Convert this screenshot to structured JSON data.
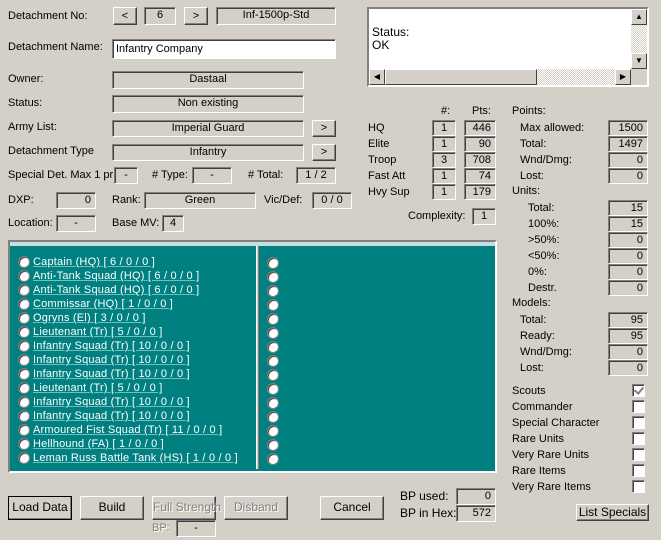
{
  "detachment": {
    "no_label": "Detachment No:",
    "prev": "<",
    "number": "6",
    "next": ">",
    "code": "Inf-1500p-Std",
    "name_label": "Detachment Name:",
    "name_value": "Infantry Company",
    "owner_label": "Owner:",
    "owner_value": "Dastaal",
    "status_label": "Status:",
    "status_value": "Non existing",
    "army_label": "Army List:",
    "army_value": "Imperial Guard",
    "army_btn": ">",
    "type_label": "Detachment Type",
    "type_value": "Infantry",
    "type_btn": ">",
    "special_label": "Special Det. Max 1 pr:",
    "special_value": "-",
    "hash_type_label": "# Type:",
    "hash_type_value": "-",
    "hash_total_label": "# Total:",
    "hash_total_value": "1 / 2",
    "dxp_label": "DXP:",
    "dxp_value": "0",
    "rank_label": "Rank:",
    "rank_value": "Green",
    "vic_label": "Vic/Def:",
    "vic_value": "0 / 0",
    "location_label": "Location:",
    "location_value": "-",
    "basemv_label": "Base MV:",
    "basemv_value": "4"
  },
  "status_box": {
    "line1": "Status:",
    "line2": "OK"
  },
  "categories": {
    "hdr_count": "#:",
    "hdr_pts": "Pts:",
    "rows": [
      {
        "name": "HQ",
        "count": "1",
        "pts": "446"
      },
      {
        "name": "Elite",
        "count": "1",
        "pts": "90"
      },
      {
        "name": "Troop",
        "count": "3",
        "pts": "708"
      },
      {
        "name": "Fast Att",
        "count": "1",
        "pts": "74"
      },
      {
        "name": "Hvy Sup",
        "count": "1",
        "pts": "179"
      }
    ],
    "complexity_label": "Complexity:",
    "complexity_value": "1"
  },
  "points": {
    "title": "Points:",
    "rows": [
      {
        "label": "Max allowed:",
        "value": "1500"
      },
      {
        "label": "Total:",
        "value": "1497"
      },
      {
        "label": "Wnd/Dmg:",
        "value": "0"
      },
      {
        "label": "Lost:",
        "value": "0"
      }
    ]
  },
  "units": {
    "title": "Units:",
    "rows": [
      {
        "label": "Total:",
        "value": "15"
      },
      {
        "label": "100%:",
        "value": "15"
      },
      {
        "label": ">50%:",
        "value": "0"
      },
      {
        "label": "<50%:",
        "value": "0"
      },
      {
        "label": "0%:",
        "value": "0"
      },
      {
        "label": "Destr.",
        "value": "0"
      }
    ]
  },
  "models": {
    "title": "Models:",
    "rows": [
      {
        "label": "Total:",
        "value": "95"
      },
      {
        "label": "Ready:",
        "value": "95"
      },
      {
        "label": "Wnd/Dmg:",
        "value": "0"
      },
      {
        "label": "Lost:",
        "value": "0"
      }
    ]
  },
  "flags": [
    {
      "label": "Scouts",
      "checked": true
    },
    {
      "label": "Commander",
      "checked": false
    },
    {
      "label": "Special Character",
      "checked": false
    },
    {
      "label": "Rare Units",
      "checked": false
    },
    {
      "label": "Very Rare Units",
      "checked": false
    },
    {
      "label": "Rare Items",
      "checked": false
    },
    {
      "label": "Very Rare Items",
      "checked": false
    }
  ],
  "unit_list": [
    "Captain  (HQ)  [ 6 / 0 / 0 ]",
    "Anti-Tank Squad  (HQ)  [ 6 / 0 / 0 ]",
    "Anti-Tank Squad  (HQ)  [ 6 / 0 / 0 ]",
    "Commissar  (HQ)  [ 1 / 0 / 0 ]",
    "Ogryns  (El)  [ 3 / 0 / 0 ]",
    "Lieutenant  (Tr)  [ 5 / 0 / 0 ]",
    "Infantry Squad  (Tr)  [ 10 / 0 / 0 ]",
    "Infantry Squad  (Tr)  [ 10 / 0 / 0 ]",
    "Infantry Squad  (Tr)  [ 10 / 0 / 0 ]",
    "Lieutenant  (Tr)  [ 5 / 0 / 0 ]",
    "Infantry Squad  (Tr)  [ 10 / 0 / 0 ]",
    "Infantry Squad  (Tr)  [ 10 / 0 / 0 ]",
    "Armoured Fist Squad  (Tr)  [ 11 / 0 / 0 ]",
    "Hellhound  (FA)  [ 1 / 0 / 0 ]",
    "Leman Russ Battle Tank  (HS)  [ 1 / 0 / 0 ]"
  ],
  "bottom": {
    "load": "Load Data",
    "build": "Build",
    "full_strength": "Full Strength",
    "disband": "Disband",
    "bp_label": "BP:",
    "bp_value": "-",
    "cancel": "Cancel",
    "bp_used_label": "BP used:",
    "bp_used_value": "0",
    "bp_hex_label": "BP in Hex:",
    "bp_hex_value": "572",
    "list_specials": "List Specials"
  }
}
